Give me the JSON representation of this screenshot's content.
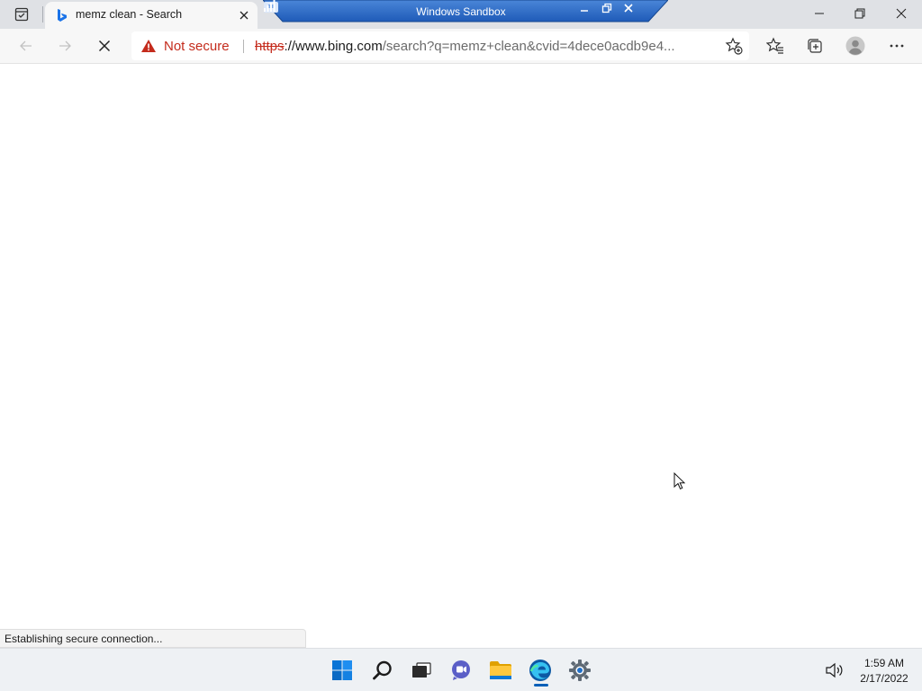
{
  "browser": {
    "tab": {
      "title": "memz clean - Search",
      "favicon": "bing-icon"
    },
    "address_bar": {
      "security_label": "Not secure",
      "url_scheme": "https",
      "url_host": "://www.bing.com",
      "url_rest": "/search?q=memz+clean&cvid=4dece0acdb9e4..."
    },
    "status_text": "Establishing secure connection..."
  },
  "sandbox_bar": {
    "title": "Windows Sandbox"
  },
  "taskbar": {
    "icons": [
      "windows-start-icon",
      "search-icon",
      "task-view-icon",
      "chat-icon",
      "file-explorer-icon",
      "edge-icon",
      "settings-icon"
    ],
    "clock_time": "1:59 AM",
    "clock_date": "2/17/2022"
  },
  "colors": {
    "accent": "#005fb8",
    "warning": "#c42b1c",
    "sandbox_bar": "#1f5bb8"
  }
}
